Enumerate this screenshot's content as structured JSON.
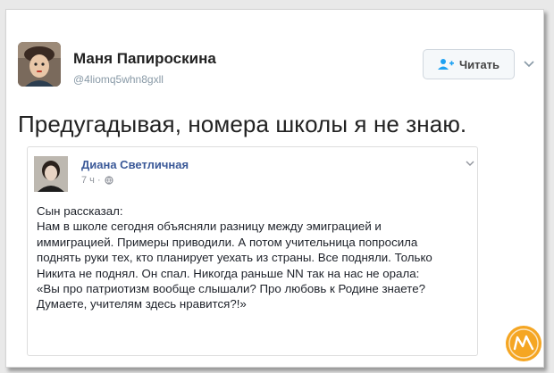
{
  "tweet": {
    "author_name": "Маня Папироскина",
    "author_handle": "@4liomq5whn8gxll",
    "follow_label": "Читать",
    "text": "Предугадывая, номера школы я не знаю.",
    "avatar_icon": "user-avatar-girl"
  },
  "quoted_post": {
    "author_name": "Диана Светличная",
    "time": "7 ч ·",
    "privacy_icon": "globe-icon",
    "body_lines": [
      "Сын рассказал:",
      "Нам в школе сегодня объясняли разницу между эмиграцией и",
      "иммиграцией. Примеры приводили. А потом учительница попросила",
      "поднять руки тех, кто планирует уехать из страны. Все подняли. Только",
      "Никита не поднял. Он спал. Никогда раньше NN так на нас не орала:",
      "«Вы про патриотизм вообще слышали? Про любовь к Родине знаете?",
      "Думаете, учителям здесь нравится?!»"
    ]
  },
  "colors": {
    "accent_blue": "#3b5998",
    "follow_icon_blue": "#1da1f2",
    "logo_orange": "#f5a623"
  }
}
